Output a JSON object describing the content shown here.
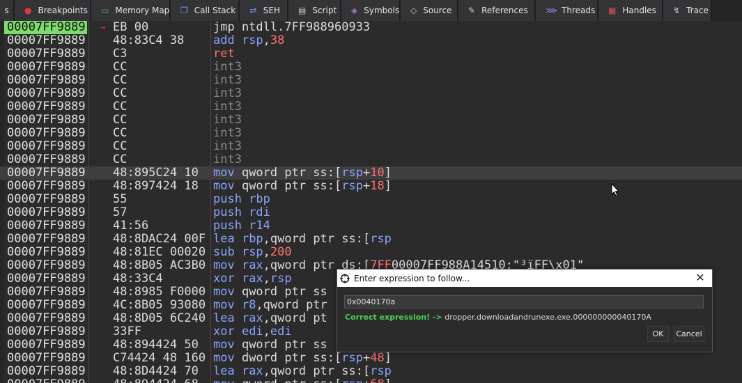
{
  "tabs": [
    {
      "label": "s",
      "icon": "notes-icon",
      "color": "#cccccc"
    },
    {
      "label": "Breakpoints",
      "icon": "breakpoint-icon",
      "color": "#e03a3a"
    },
    {
      "label": "Memory Map",
      "icon": "memory-map-icon",
      "color": "#52c052"
    },
    {
      "label": "Call Stack",
      "icon": "call-stack-icon",
      "color": "#7aa8e8"
    },
    {
      "label": "SEH",
      "icon": "seh-icon",
      "color": "#6a8fe0"
    },
    {
      "label": "Script",
      "icon": "script-icon",
      "color": "#cccccc"
    },
    {
      "label": "Symbols",
      "icon": "symbols-icon",
      "color": "#b07acd"
    },
    {
      "label": "Source",
      "icon": "source-icon",
      "color": "#cccccc"
    },
    {
      "label": "References",
      "icon": "references-icon",
      "color": "#cccccc"
    },
    {
      "label": "Threads",
      "icon": "threads-icon",
      "color": "#8a8ae0"
    },
    {
      "label": "Handles",
      "icon": "handles-icon",
      "color": "#d05050"
    },
    {
      "label": "Trace",
      "icon": "trace-icon",
      "color": "#cccccc"
    }
  ],
  "disassembly": [
    {
      "addr": "00007FF9889",
      "bytes": "EB 00",
      "instr": [
        {
          "t": "jmp ntdll.7FF988960933",
          "c": "w"
        }
      ],
      "selected": true,
      "arrow": "→"
    },
    {
      "addr": "00007FF9889",
      "bytes": "48:83C4 38",
      "instr": [
        {
          "t": "add ",
          "c": "m"
        },
        {
          "t": "rsp",
          "c": "m"
        },
        {
          "t": ",",
          "c": "w"
        },
        {
          "t": "38",
          "c": "r"
        }
      ]
    },
    {
      "addr": "00007FF9889",
      "bytes": "C3",
      "instr": [
        {
          "t": "ret",
          "c": "r"
        }
      ]
    },
    {
      "addr": "00007FF9889",
      "bytes": "CC",
      "instr": [
        {
          "t": "int3",
          "c": "p"
        }
      ]
    },
    {
      "addr": "00007FF9889",
      "bytes": "CC",
      "instr": [
        {
          "t": "int3",
          "c": "p"
        }
      ]
    },
    {
      "addr": "00007FF9889",
      "bytes": "CC",
      "instr": [
        {
          "t": "int3",
          "c": "p"
        }
      ]
    },
    {
      "addr": "00007FF9889",
      "bytes": "CC",
      "instr": [
        {
          "t": "int3",
          "c": "p"
        }
      ]
    },
    {
      "addr": "00007FF9889",
      "bytes": "CC",
      "instr": [
        {
          "t": "int3",
          "c": "p"
        }
      ]
    },
    {
      "addr": "00007FF9889",
      "bytes": "CC",
      "instr": [
        {
          "t": "int3",
          "c": "p"
        }
      ]
    },
    {
      "addr": "00007FF9889",
      "bytes": "CC",
      "instr": [
        {
          "t": "int3",
          "c": "p"
        }
      ]
    },
    {
      "addr": "00007FF9889",
      "bytes": "CC",
      "instr": [
        {
          "t": "int3",
          "c": "p"
        }
      ]
    },
    {
      "addr": "00007FF9889",
      "bytes": "48:895C24 10",
      "instr": [
        {
          "t": "mov ",
          "c": "m"
        },
        {
          "t": "qword ptr ss:[",
          "c": "w"
        },
        {
          "t": "rsp",
          "c": "m"
        },
        {
          "t": "+",
          "c": "w"
        },
        {
          "t": "10",
          "c": "r"
        },
        {
          "t": "]",
          "c": "w"
        }
      ],
      "current": true
    },
    {
      "addr": "00007FF9889",
      "bytes": "48:897424 18",
      "instr": [
        {
          "t": "mov ",
          "c": "m"
        },
        {
          "t": "qword ptr ss:[",
          "c": "w"
        },
        {
          "t": "rsp",
          "c": "m"
        },
        {
          "t": "+",
          "c": "w"
        },
        {
          "t": "18",
          "c": "r"
        },
        {
          "t": "]",
          "c": "w"
        }
      ]
    },
    {
      "addr": "00007FF9889",
      "bytes": "55",
      "instr": [
        {
          "t": "push ",
          "c": "m"
        },
        {
          "t": "rbp",
          "c": "m"
        }
      ]
    },
    {
      "addr": "00007FF9889",
      "bytes": "57",
      "instr": [
        {
          "t": "push ",
          "c": "m"
        },
        {
          "t": "rdi",
          "c": "m"
        }
      ]
    },
    {
      "addr": "00007FF9889",
      "bytes": "41:56",
      "instr": [
        {
          "t": "push ",
          "c": "m"
        },
        {
          "t": "r14",
          "c": "m"
        }
      ]
    },
    {
      "addr": "00007FF9889",
      "bytes": "48:8DAC24 00F",
      "instr": [
        {
          "t": "lea ",
          "c": "m"
        },
        {
          "t": "rbp",
          "c": "m"
        },
        {
          "t": ",qword ptr ss:[",
          "c": "w"
        },
        {
          "t": "rsp",
          "c": "m"
        }
      ]
    },
    {
      "addr": "00007FF9889",
      "bytes": "48:81EC 00020",
      "instr": [
        {
          "t": "sub ",
          "c": "m"
        },
        {
          "t": "rsp",
          "c": "m"
        },
        {
          "t": ",",
          "c": "w"
        },
        {
          "t": "200",
          "c": "r"
        }
      ]
    },
    {
      "addr": "00007FF9889",
      "bytes": "48:8B05 AC3B0",
      "instr": [
        {
          "t": "mov ",
          "c": "m"
        },
        {
          "t": "rax",
          "c": "m"
        },
        {
          "t": ",qword ptr ds:[",
          "c": "w"
        },
        {
          "t": "7FF",
          "c": "r"
        },
        {
          "t": "00007FF988A14510:\"³ïFF\\x01\"",
          "c": "w"
        }
      ]
    },
    {
      "addr": "00007FF9889",
      "bytes": "48:33C4",
      "instr": [
        {
          "t": "xor ",
          "c": "m"
        },
        {
          "t": "rax",
          "c": "m"
        },
        {
          "t": ",",
          "c": "w"
        },
        {
          "t": "rsp",
          "c": "m"
        }
      ]
    },
    {
      "addr": "00007FF9889",
      "bytes": "48:8985 F0000",
      "instr": [
        {
          "t": "mov ",
          "c": "m"
        },
        {
          "t": "qword ptr ss",
          "c": "w"
        }
      ]
    },
    {
      "addr": "00007FF9889",
      "bytes": "4C:8B05 93080",
      "instr": [
        {
          "t": "mov ",
          "c": "m"
        },
        {
          "t": "r8",
          "c": "m"
        },
        {
          "t": ",qword ptr",
          "c": "w"
        }
      ]
    },
    {
      "addr": "00007FF9889",
      "bytes": "48:8D05 6C240",
      "instr": [
        {
          "t": "lea ",
          "c": "m"
        },
        {
          "t": "rax",
          "c": "m"
        },
        {
          "t": ",qword pt",
          "c": "w"
        }
      ]
    },
    {
      "addr": "00007FF9889",
      "bytes": "33FF",
      "instr": [
        {
          "t": "xor ",
          "c": "m"
        },
        {
          "t": "edi",
          "c": "m"
        },
        {
          "t": ",",
          "c": "w"
        },
        {
          "t": "edi",
          "c": "m"
        }
      ]
    },
    {
      "addr": "00007FF9889",
      "bytes": "48:894424 50",
      "instr": [
        {
          "t": "mov ",
          "c": "m"
        },
        {
          "t": "qword ptr ss",
          "c": "w"
        }
      ]
    },
    {
      "addr": "00007FF9889",
      "bytes": "C74424 48 160",
      "instr": [
        {
          "t": "mov ",
          "c": "m"
        },
        {
          "t": "dword ptr ss:[",
          "c": "w"
        },
        {
          "t": "rsp",
          "c": "m"
        },
        {
          "t": "+",
          "c": "w"
        },
        {
          "t": "48",
          "c": "r"
        },
        {
          "t": "]",
          "c": "w"
        }
      ]
    },
    {
      "addr": "00007FF9889",
      "bytes": "48:8D4424 70",
      "instr": [
        {
          "t": "lea ",
          "c": "m"
        },
        {
          "t": "rax",
          "c": "m"
        },
        {
          "t": ",qword ptr ss:[",
          "c": "w"
        },
        {
          "t": "rsp",
          "c": "m"
        }
      ]
    },
    {
      "addr": "00007FF9889",
      "bytes": "48:894424 68",
      "instr": [
        {
          "t": "mov ",
          "c": "m"
        },
        {
          "t": "qword ptr ss:[",
          "c": "w"
        },
        {
          "t": "rsp",
          "c": "m"
        },
        {
          "t": "+",
          "c": "w"
        },
        {
          "t": "68",
          "c": "r"
        },
        {
          "t": "]",
          "c": "w"
        }
      ]
    }
  ],
  "dialog": {
    "title": "Enter expression to follow...",
    "input_value": "0x0040170a",
    "status_ok": "Correct expression! ->",
    "status_result": "dropper.downloadandrunexe.exe.000000000040170A",
    "ok_label": "OK",
    "cancel_label": "Cancel",
    "close_glyph": "✕"
  },
  "colors": {
    "selected_addr": "#7ddc6e",
    "mnemonic": "#8aa4ff",
    "number": "#ff7070",
    "padding_op": "#8a8a8a",
    "success_text": "#4ccf52"
  }
}
